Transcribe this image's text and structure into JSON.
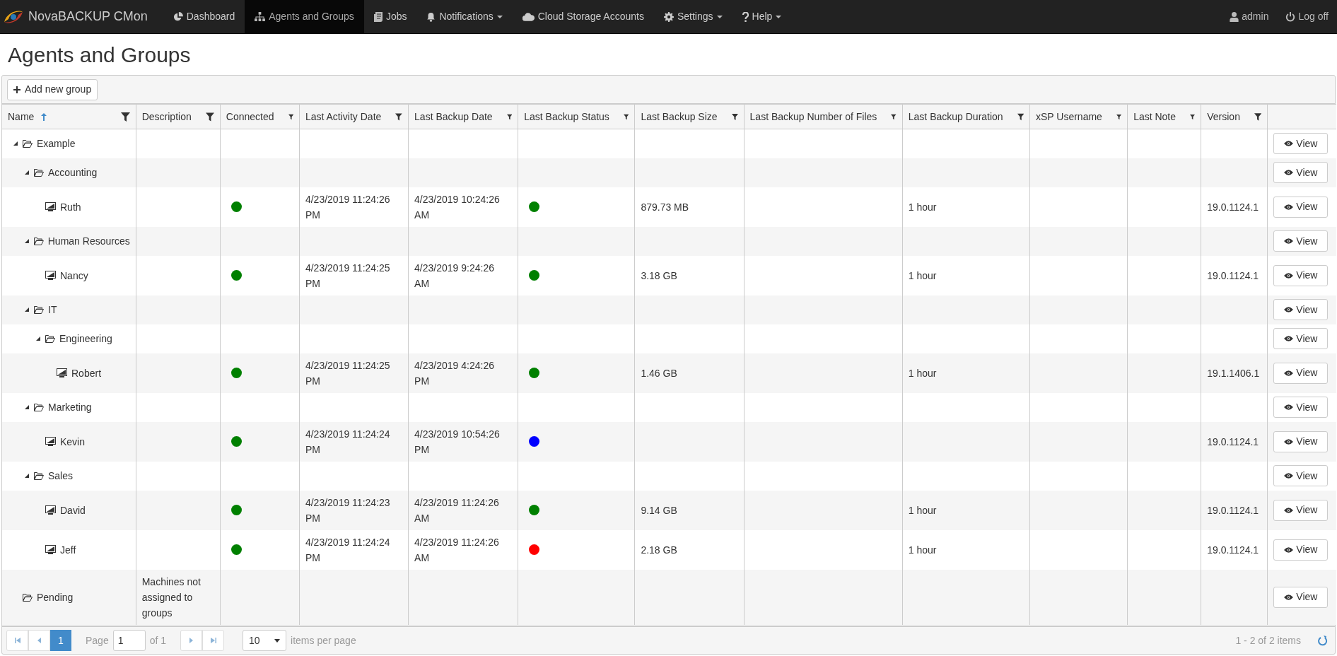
{
  "navbar": {
    "brand": "NovaBACKUP CMon",
    "items": [
      {
        "label": "Dashboard",
        "selected": false,
        "has_menu": false
      },
      {
        "label": "Agents and Groups",
        "selected": true,
        "has_menu": false
      },
      {
        "label": "Jobs",
        "selected": false,
        "has_menu": false
      },
      {
        "label": "Notifications",
        "selected": false,
        "has_menu": true
      },
      {
        "label": "Cloud Storage Accounts",
        "selected": false,
        "has_menu": false
      },
      {
        "label": "Settings",
        "selected": false,
        "has_menu": true
      },
      {
        "label": "Help",
        "selected": false,
        "has_menu": true
      }
    ],
    "right_items": [
      {
        "label": "admin"
      },
      {
        "label": "Log off"
      }
    ]
  },
  "page_title": "Agents and Groups",
  "toolbar": {
    "add_button": "Add new group"
  },
  "table": {
    "columns": [
      {
        "label": "Name",
        "sorted_ascending": true
      },
      {
        "label": "Description",
        "sorted_ascending": false
      },
      {
        "label": "Connected",
        "sorted_ascending": false
      },
      {
        "label": "Last Activity Date",
        "sorted_ascending": false
      },
      {
        "label": "Last Backup Date",
        "sorted_ascending": false
      },
      {
        "label": "Last Backup Status",
        "sorted_ascending": false
      },
      {
        "label": "Last Backup Size",
        "sorted_ascending": false
      },
      {
        "label": "Last Backup Number of Files",
        "sorted_ascending": false
      },
      {
        "label": "Last Backup Duration",
        "sorted_ascending": false
      },
      {
        "label": "xSP Username",
        "sorted_ascending": false
      },
      {
        "label": "Last Note",
        "sorted_ascending": false
      },
      {
        "label": "Version",
        "sorted_ascending": false
      }
    ],
    "rows": [
      {
        "kind": "group",
        "name": "Example",
        "expanded": true,
        "action": "View",
        "children": [
          {
            "kind": "group",
            "name": "Accounting",
            "expanded": true,
            "action": "View",
            "children": [
              {
                "kind": "agent",
                "name": "Ruth",
                "connected": {
                  "color": "#008000"
                },
                "last_activity": "4/23/2019 11:24:26 PM",
                "last_backup": "4/23/2019 10:24:26 AM",
                "status": {
                  "color": "#008000"
                },
                "size": "879.73 MB",
                "duration": "1 hour",
                "version": "19.0.1124.1",
                "action": "View"
              }
            ]
          },
          {
            "kind": "group",
            "name": "Human Resources",
            "expanded": true,
            "action": "View",
            "children": [
              {
                "kind": "agent",
                "name": "Nancy",
                "connected": {
                  "color": "#008000"
                },
                "last_activity": "4/23/2019 11:24:25 PM",
                "last_backup": "4/23/2019 9:24:26 AM",
                "status": {
                  "color": "#008000"
                },
                "size": "3.18 GB",
                "duration": "1 hour",
                "version": "19.0.1124.1",
                "action": "View"
              }
            ]
          },
          {
            "kind": "group",
            "name": "IT",
            "expanded": true,
            "action": "View",
            "children": [
              {
                "kind": "group",
                "name": "Engineering",
                "expanded": true,
                "action": "View",
                "children": [
                  {
                    "kind": "agent",
                    "name": "Robert",
                    "connected": {
                      "color": "#008000"
                    },
                    "last_activity": "4/23/2019 11:24:25 PM",
                    "last_backup": "4/23/2019 4:24:26 PM",
                    "status": {
                      "color": "#008000"
                    },
                    "size": "1.46 GB",
                    "duration": "1 hour",
                    "version": "19.1.1406.1",
                    "action": "View"
                  }
                ]
              }
            ]
          },
          {
            "kind": "group",
            "name": "Marketing",
            "expanded": true,
            "action": "View",
            "children": [
              {
                "kind": "agent",
                "name": "Kevin",
                "connected": {
                  "color": "#008000"
                },
                "last_activity": "4/23/2019 11:24:24 PM",
                "last_backup": "4/23/2019 10:54:26 PM",
                "status": {
                  "color": "#0000ff"
                },
                "version": "19.0.1124.1",
                "action": "View"
              }
            ]
          },
          {
            "kind": "group",
            "name": "Sales",
            "expanded": true,
            "action": "View",
            "children": [
              {
                "kind": "agent",
                "name": "David",
                "connected": {
                  "color": "#008000"
                },
                "last_activity": "4/23/2019 11:24:23 PM",
                "last_backup": "4/23/2019 11:24:26 AM",
                "status": {
                  "color": "#008000"
                },
                "size": "9.14 GB",
                "duration": "1 hour",
                "version": "19.0.1124.1",
                "action": "View"
              },
              {
                "kind": "agent",
                "name": "Jeff",
                "connected": {
                  "color": "#008000"
                },
                "last_activity": "4/23/2019 11:24:24 PM",
                "last_backup": "4/23/2019 11:24:26 AM",
                "status": {
                  "color": "#ff0000"
                },
                "size": "2.18 GB",
                "duration": "1 hour",
                "version": "19.0.1124.1",
                "action": "View"
              }
            ]
          }
        ]
      },
      {
        "kind": "group",
        "name": "Pending",
        "description": "Machines not assigned to groups",
        "action": "View"
      }
    ]
  },
  "pager": {
    "pages": [
      {
        "label": "1",
        "selected": true
      }
    ],
    "page_label": "Page",
    "page_value": "1",
    "of_label": "of 1",
    "page_size": "10",
    "page_size_label": "items per page",
    "summary": "1 - 2 of 2 items"
  }
}
